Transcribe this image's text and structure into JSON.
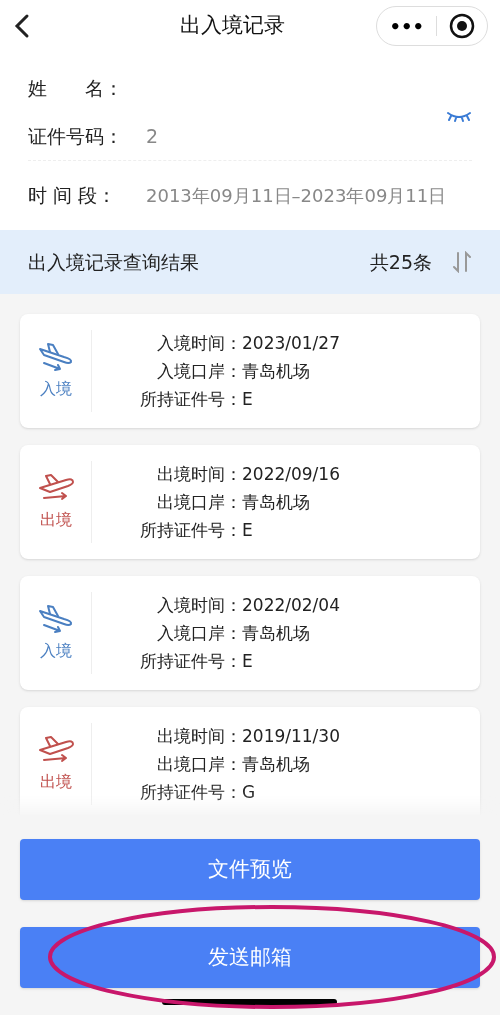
{
  "header": {
    "title": "出入境记录",
    "menu_button": "•••"
  },
  "info": [
    {
      "label": "姓　　名："
    },
    {
      "label": "证件号码：",
      "value": "2"
    },
    {
      "label": "时  间  段：",
      "value": "2013年09月11日–2023年09月11日"
    }
  ],
  "results_bar": {
    "title": "出入境记录查询结果",
    "count": "共25条"
  },
  "records": [
    {
      "kind": "entry",
      "direction": "入境",
      "rows": [
        {
          "label": "入境时间：",
          "value": "2023/01/27"
        },
        {
          "label": "入境口岸：",
          "value": "青岛机场"
        },
        {
          "label": "所持证件号：",
          "value": "E"
        }
      ]
    },
    {
      "kind": "exit",
      "direction": "出境",
      "rows": [
        {
          "label": "出境时间：",
          "value": "2022/09/16"
        },
        {
          "label": "出境口岸：",
          "value": "青岛机场"
        },
        {
          "label": "所持证件号：",
          "value": "E"
        }
      ]
    },
    {
      "kind": "entry",
      "direction": "入境",
      "rows": [
        {
          "label": "入境时间：",
          "value": "2022/02/04"
        },
        {
          "label": "入境口岸：",
          "value": "青岛机场"
        },
        {
          "label": "所持证件号：",
          "value": "E"
        }
      ]
    },
    {
      "kind": "exit",
      "direction": "出境",
      "rows": [
        {
          "label": "出境时间：",
          "value": "2019/11/30"
        },
        {
          "label": "出境口岸：",
          "value": "青岛机场"
        },
        {
          "label": "所持证件号：",
          "value": "G"
        }
      ]
    }
  ],
  "buttons": [
    "文件预览",
    "发送邮箱"
  ]
}
